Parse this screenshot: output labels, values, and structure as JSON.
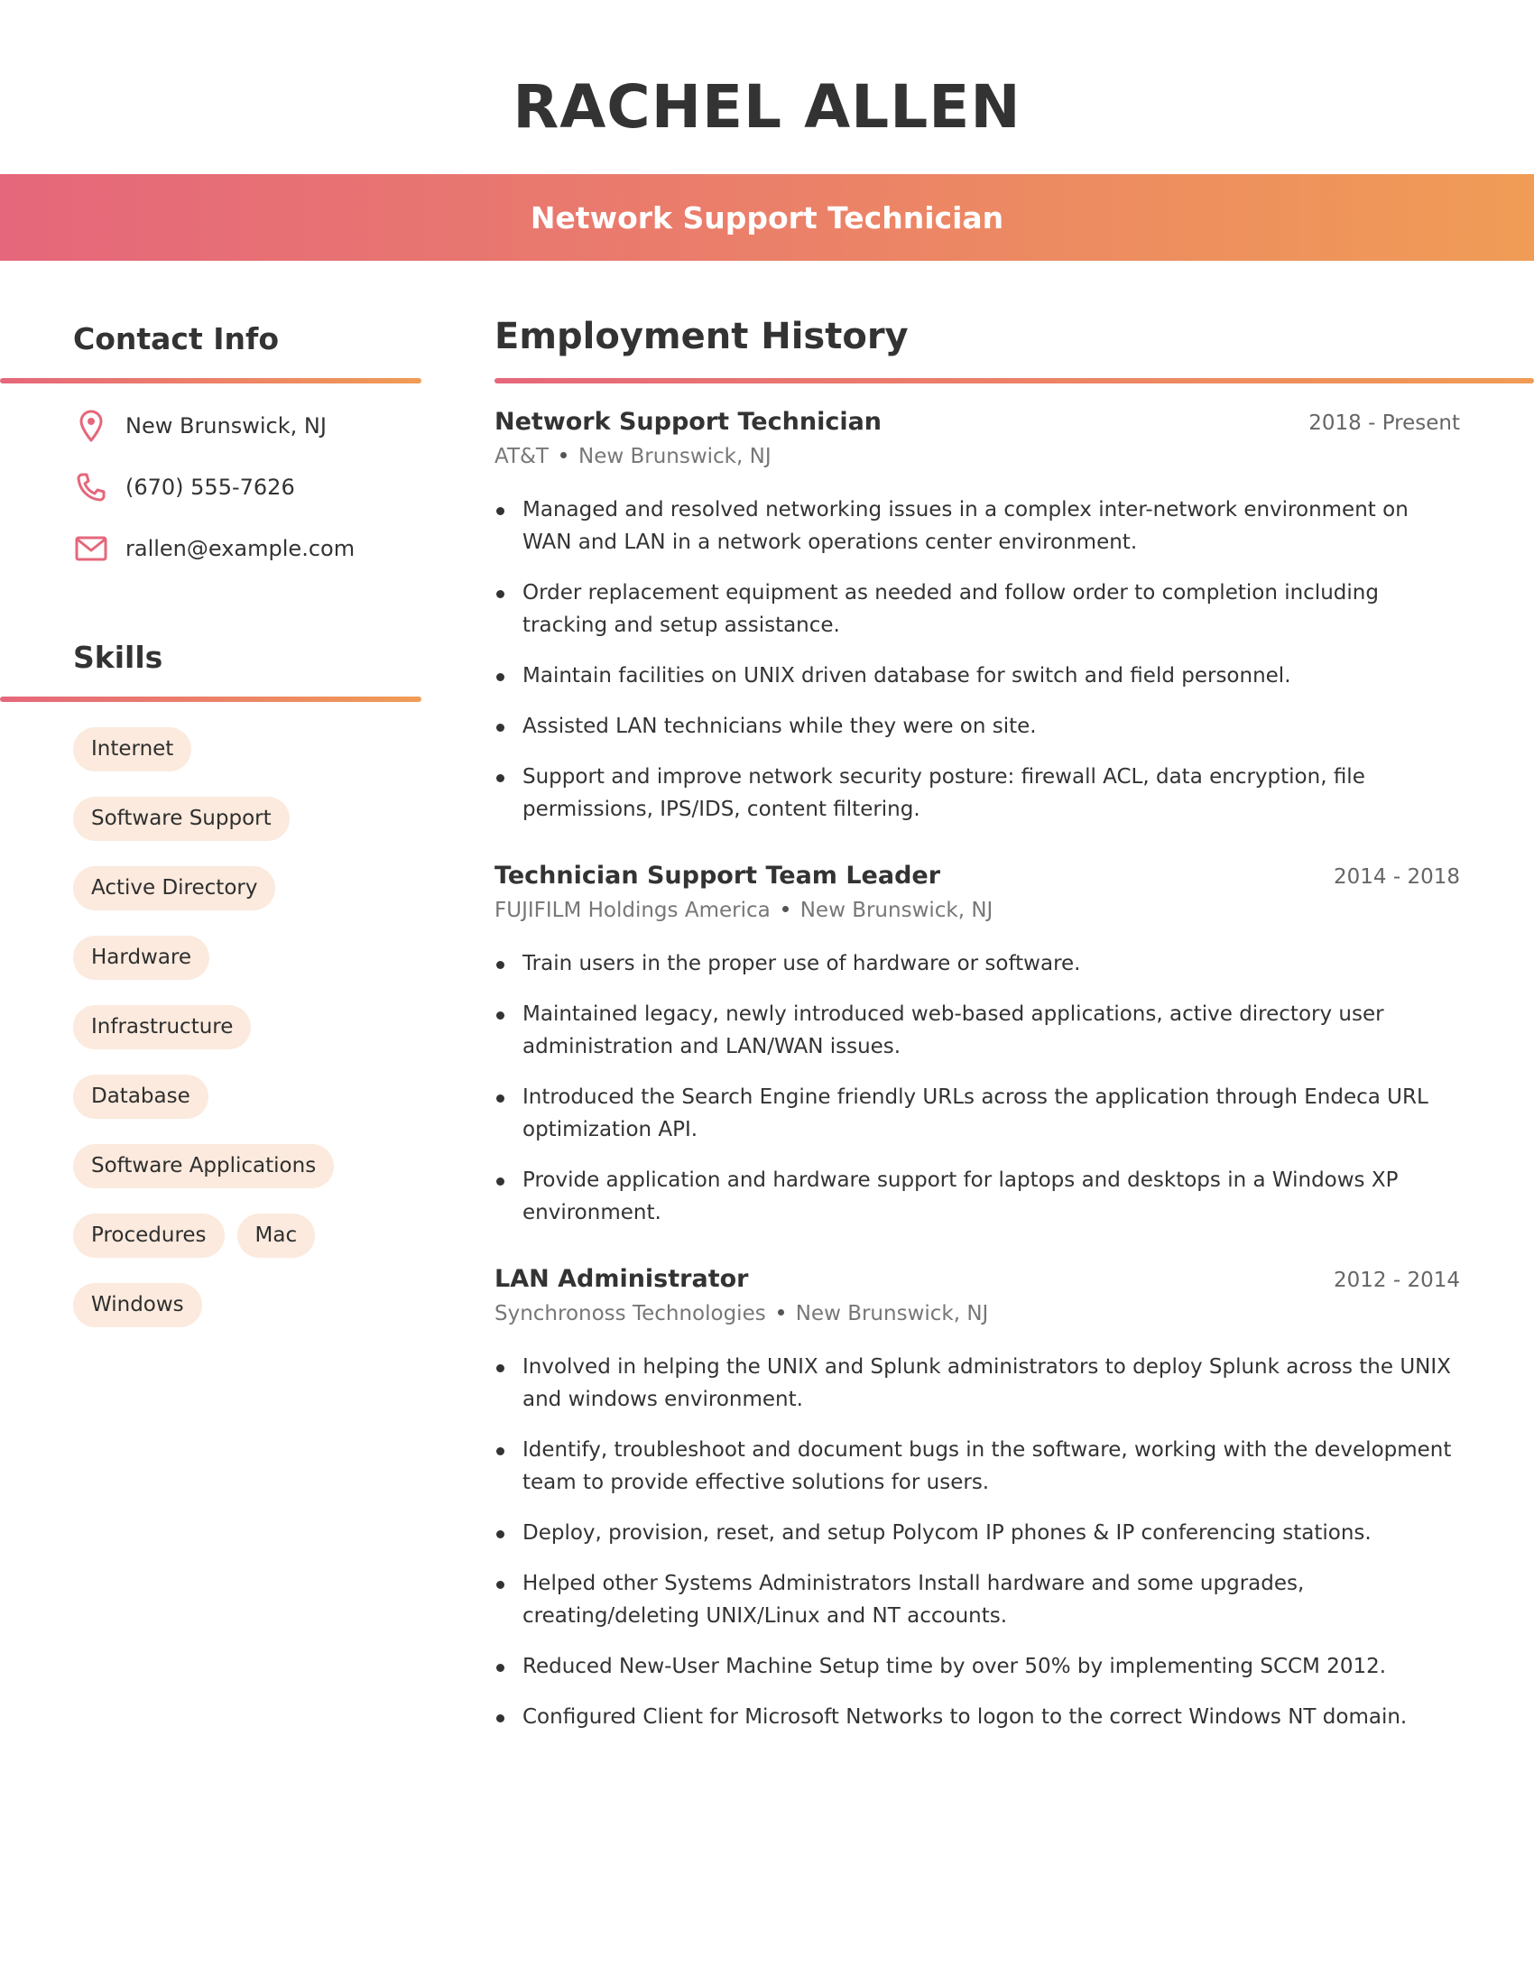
{
  "header": {
    "name": "RACHEL ALLEN",
    "title": "Network Support Technician"
  },
  "contact": {
    "heading": "Contact Info",
    "items": [
      {
        "icon": "location-pin-icon",
        "text": "New Brunswick, NJ"
      },
      {
        "icon": "phone-icon",
        "text": "(670) 555-7626"
      },
      {
        "icon": "email-icon",
        "text": "rallen@example.com"
      }
    ]
  },
  "skills": {
    "heading": "Skills",
    "items": [
      "Internet",
      "Software Support",
      "Active Directory",
      "Hardware",
      "Infrastructure",
      "Database",
      "Software Applications",
      "Procedures",
      "Mac",
      "Windows"
    ]
  },
  "employment": {
    "heading": "Employment History",
    "jobs": [
      {
        "title": "Network Support Technician",
        "dates": "2018 - Present",
        "company": "AT&T",
        "location": "New Brunswick, NJ",
        "bullets": [
          "Managed and resolved networking issues in a complex inter-network environment on WAN and LAN in a network operations center environment.",
          "Order replacement equipment as needed and follow order to completion including tracking and setup assistance.",
          "Maintain facilities on UNIX driven database for switch and field personnel.",
          "Assisted LAN technicians while they were on site.",
          "Support and improve network security posture: firewall ACL, data encryption, file permissions, IPS/IDS, content filtering."
        ]
      },
      {
        "title": "Technician Support Team Leader",
        "dates": "2014 - 2018",
        "company": "FUJIFILM Holdings America",
        "location": "New Brunswick, NJ",
        "bullets": [
          "Train users in the proper use of hardware or software.",
          "Maintained legacy, newly introduced web-based applications, active directory user administration and LAN/WAN issues.",
          "Introduced the Search Engine friendly URLs across the application through Endeca URL optimization API.",
          "Provide application and hardware support for laptops and desktops in a Windows XP environment."
        ]
      },
      {
        "title": "LAN Administrator",
        "dates": "2012 - 2014",
        "company": "Synchronoss Technologies",
        "location": "New Brunswick, NJ",
        "bullets": [
          "Involved in helping the UNIX and Splunk administrators to deploy Splunk across the UNIX and windows environment.",
          "Identify, troubleshoot and document bugs in the software, working with the development team to provide effective solutions for users.",
          "Deploy, provision, reset, and setup Polycom IP phones & IP conferencing stations.",
          "Helped other Systems Administrators Install hardware and some upgrades, creating/deleting UNIX/Linux and NT accounts.",
          "Reduced New-User Machine Setup time by over 50% by implementing SCCM 2012.",
          "Configured Client for Microsoft Networks to logon to the correct Windows NT domain."
        ]
      }
    ]
  },
  "colors": {
    "accent_pink": "#e5677b",
    "accent_orange": "#f09c56",
    "chip_bg": "#fbeadd",
    "text": "#333333"
  }
}
